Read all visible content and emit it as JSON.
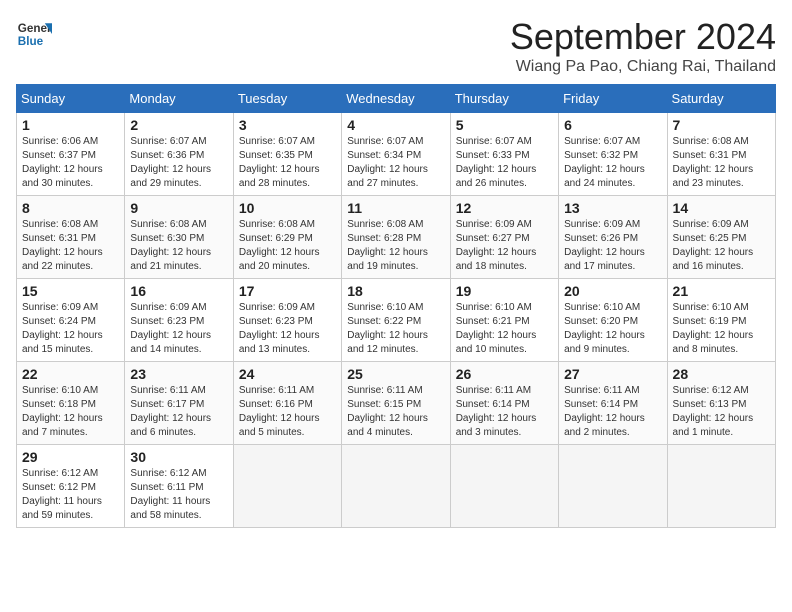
{
  "logo": {
    "line1": "General",
    "line2": "Blue"
  },
  "title": "September 2024",
  "location": "Wiang Pa Pao, Chiang Rai, Thailand",
  "days_header": [
    "Sunday",
    "Monday",
    "Tuesday",
    "Wednesday",
    "Thursday",
    "Friday",
    "Saturday"
  ],
  "weeks": [
    [
      {
        "num": "1",
        "rise": "6:06 AM",
        "set": "6:37 PM",
        "daylight": "12 hours and 30 minutes."
      },
      {
        "num": "2",
        "rise": "6:07 AM",
        "set": "6:36 PM",
        "daylight": "12 hours and 29 minutes."
      },
      {
        "num": "3",
        "rise": "6:07 AM",
        "set": "6:35 PM",
        "daylight": "12 hours and 28 minutes."
      },
      {
        "num": "4",
        "rise": "6:07 AM",
        "set": "6:34 PM",
        "daylight": "12 hours and 27 minutes."
      },
      {
        "num": "5",
        "rise": "6:07 AM",
        "set": "6:33 PM",
        "daylight": "12 hours and 26 minutes."
      },
      {
        "num": "6",
        "rise": "6:07 AM",
        "set": "6:32 PM",
        "daylight": "12 hours and 24 minutes."
      },
      {
        "num": "7",
        "rise": "6:08 AM",
        "set": "6:31 PM",
        "daylight": "12 hours and 23 minutes."
      }
    ],
    [
      {
        "num": "8",
        "rise": "6:08 AM",
        "set": "6:31 PM",
        "daylight": "12 hours and 22 minutes."
      },
      {
        "num": "9",
        "rise": "6:08 AM",
        "set": "6:30 PM",
        "daylight": "12 hours and 21 minutes."
      },
      {
        "num": "10",
        "rise": "6:08 AM",
        "set": "6:29 PM",
        "daylight": "12 hours and 20 minutes."
      },
      {
        "num": "11",
        "rise": "6:08 AM",
        "set": "6:28 PM",
        "daylight": "12 hours and 19 minutes."
      },
      {
        "num": "12",
        "rise": "6:09 AM",
        "set": "6:27 PM",
        "daylight": "12 hours and 18 minutes."
      },
      {
        "num": "13",
        "rise": "6:09 AM",
        "set": "6:26 PM",
        "daylight": "12 hours and 17 minutes."
      },
      {
        "num": "14",
        "rise": "6:09 AM",
        "set": "6:25 PM",
        "daylight": "12 hours and 16 minutes."
      }
    ],
    [
      {
        "num": "15",
        "rise": "6:09 AM",
        "set": "6:24 PM",
        "daylight": "12 hours and 15 minutes."
      },
      {
        "num": "16",
        "rise": "6:09 AM",
        "set": "6:23 PM",
        "daylight": "12 hours and 14 minutes."
      },
      {
        "num": "17",
        "rise": "6:09 AM",
        "set": "6:23 PM",
        "daylight": "12 hours and 13 minutes."
      },
      {
        "num": "18",
        "rise": "6:10 AM",
        "set": "6:22 PM",
        "daylight": "12 hours and 12 minutes."
      },
      {
        "num": "19",
        "rise": "6:10 AM",
        "set": "6:21 PM",
        "daylight": "12 hours and 10 minutes."
      },
      {
        "num": "20",
        "rise": "6:10 AM",
        "set": "6:20 PM",
        "daylight": "12 hours and 9 minutes."
      },
      {
        "num": "21",
        "rise": "6:10 AM",
        "set": "6:19 PM",
        "daylight": "12 hours and 8 minutes."
      }
    ],
    [
      {
        "num": "22",
        "rise": "6:10 AM",
        "set": "6:18 PM",
        "daylight": "12 hours and 7 minutes."
      },
      {
        "num": "23",
        "rise": "6:11 AM",
        "set": "6:17 PM",
        "daylight": "12 hours and 6 minutes."
      },
      {
        "num": "24",
        "rise": "6:11 AM",
        "set": "6:16 PM",
        "daylight": "12 hours and 5 minutes."
      },
      {
        "num": "25",
        "rise": "6:11 AM",
        "set": "6:15 PM",
        "daylight": "12 hours and 4 minutes."
      },
      {
        "num": "26",
        "rise": "6:11 AM",
        "set": "6:14 PM",
        "daylight": "12 hours and 3 minutes."
      },
      {
        "num": "27",
        "rise": "6:11 AM",
        "set": "6:14 PM",
        "daylight": "12 hours and 2 minutes."
      },
      {
        "num": "28",
        "rise": "6:12 AM",
        "set": "6:13 PM",
        "daylight": "12 hours and 1 minute."
      }
    ],
    [
      {
        "num": "29",
        "rise": "6:12 AM",
        "set": "6:12 PM",
        "daylight": "11 hours and 59 minutes."
      },
      {
        "num": "30",
        "rise": "6:12 AM",
        "set": "6:11 PM",
        "daylight": "11 hours and 58 minutes."
      },
      null,
      null,
      null,
      null,
      null
    ]
  ]
}
